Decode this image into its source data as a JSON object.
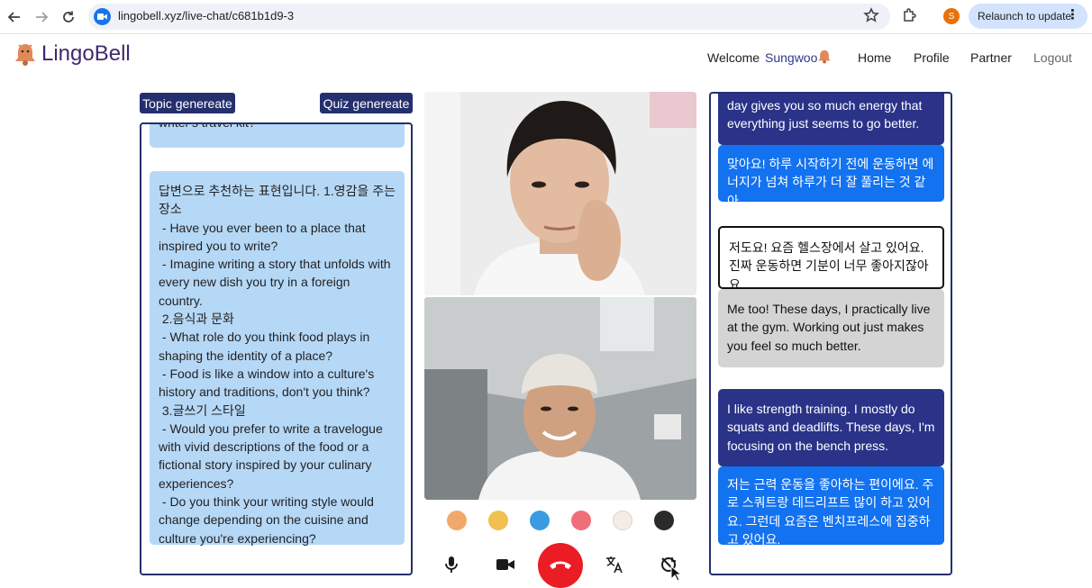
{
  "browser": {
    "url": "lingobell.xyz/live-chat/c681b1d9-3",
    "profile_initial": "S",
    "relaunch_label": "Relaunch to update"
  },
  "header": {
    "logo_text": "LingoBell",
    "welcome_label": "Welcome",
    "user_name": "Sungwoo",
    "nav": {
      "home": "Home",
      "profile": "Profile",
      "partner": "Partner",
      "logout": "Logout"
    }
  },
  "left_panel": {
    "topic_button": "Topic genereate",
    "quiz_button": "Quiz genereate",
    "top_bubble_text": "writer's travel kit?",
    "main_bubble_text": "답변으로 추천하는 표현입니다. 1.영감을 주는 장소\n - Have you ever been to a place that inspired you to write?\n - Imagine writing a story that unfolds with every new dish you try in a foreign country.\n 2.음식과 문화\n - What role do you think food plays in shaping the identity of a place?\n - Food is like a window into a culture's history and traditions, don't you think?\n 3.글쓰기 스타일\n - Would you prefer to write a travelogue with vivid descriptions of the food or a fictional story inspired by your culinary experiences?\n - Do you think your writing style would change depending on the cuisine and culture you're experiencing?"
  },
  "video": {
    "reactions": [
      "hamster",
      "laughing-face",
      "crying-face",
      "pink-blob",
      "grinning-face",
      "panda-face"
    ]
  },
  "controls": [
    "microphone",
    "camera",
    "hang-up",
    "translate",
    "sync-off"
  ],
  "chat": {
    "messages": [
      {
        "style": "navy",
        "text": "day gives you so much energy that everything just seems to go better."
      },
      {
        "style": "blue",
        "text": "맞아요! 하루 시작하기 전에 운동하면 에너지가 넘쳐 하루가 더 잘 풀리는 것 같아."
      },
      {
        "style": "outline",
        "text": "저도요! 요즘 헬스장에서 살고 있어요. 진짜 운동하면 기분이 너무 좋아지잖아요."
      },
      {
        "style": "grey",
        "text": "Me too! These days, I practically live at the gym. Working out just makes you feel so much better."
      },
      {
        "style": "navy",
        "text": "I like strength training. I mostly do squats and deadlifts. These days, I'm focusing on the bench press."
      },
      {
        "style": "blue",
        "text": "저는 근력 운동을 좋아하는 편이에요. 주로 스쿼트랑 데드리프트 많이 하고 있어요. 그런데 요즘은 벤치프레스에 집중하고 있어요."
      }
    ]
  },
  "colors": {
    "navy": "#24306e",
    "bubble_light": "#b6d8f7",
    "message_blue": "#1272f0",
    "hangup_red": "#ea1c24"
  }
}
